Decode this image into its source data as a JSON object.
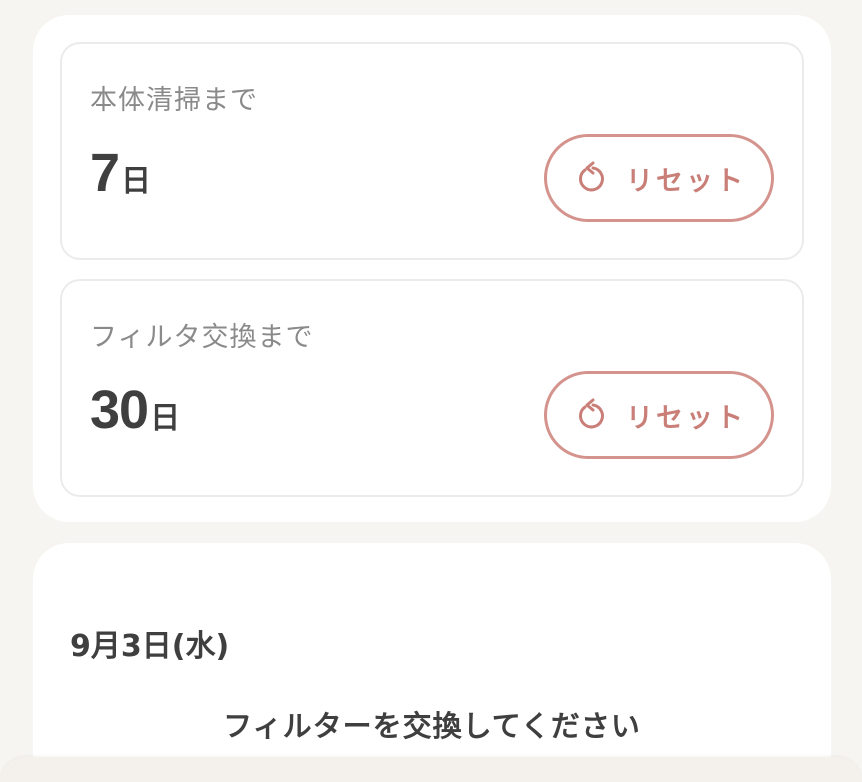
{
  "timers": [
    {
      "title": "本体清掃まで",
      "count": "7",
      "unit": "日",
      "reset_label": "リセット"
    },
    {
      "title": "フィルタ交換まで",
      "count": "30",
      "unit": "日",
      "reset_label": "リセット"
    }
  ],
  "notice": {
    "date": "9月3日(水)",
    "message": "フィルターを交換してください"
  },
  "colors": {
    "accent": "#d4938c",
    "text": "#3f3f3f",
    "muted": "#8a8a8a",
    "background": "#f7f5f1"
  },
  "icons": {
    "reset": "refresh-icon"
  }
}
